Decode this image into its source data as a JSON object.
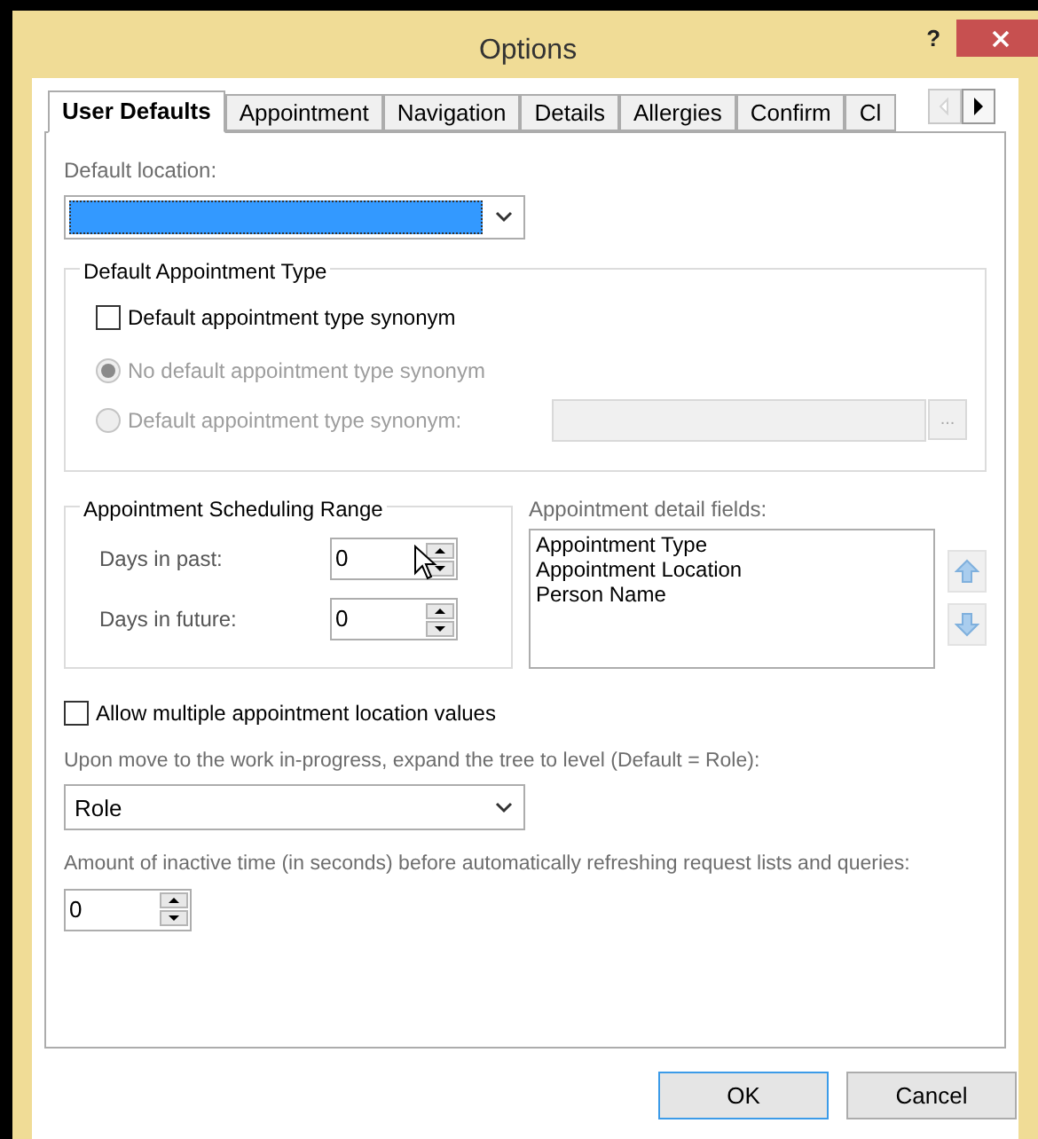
{
  "window": {
    "title": "Options",
    "help": "?"
  },
  "tabs": [
    {
      "label": "User Defaults",
      "selected": true
    },
    {
      "label": "Appointment",
      "selected": false
    },
    {
      "label": "Navigation",
      "selected": false
    },
    {
      "label": "Details",
      "selected": false
    },
    {
      "label": "Allergies",
      "selected": false
    },
    {
      "label": "Confirm",
      "selected": false
    },
    {
      "label": "Cl",
      "selected": false
    }
  ],
  "default_location": {
    "label": "Default location:",
    "highlighted": true
  },
  "appointment_type": {
    "title": "Default Appointment Type",
    "checkbox": {
      "label": "Default appointment type synonym",
      "checked": false
    },
    "radios": [
      {
        "label": "No default appointment type synonym",
        "selected": true,
        "disabled": true
      },
      {
        "label": "Default appointment type synonym:",
        "selected": false,
        "disabled": true
      }
    ],
    "browse_button": "..."
  },
  "scheduling_range": {
    "title": "Appointment Scheduling Range",
    "fields": [
      {
        "label": "Days in past:",
        "value": "0"
      },
      {
        "label": "Days in future:",
        "value": "0"
      }
    ]
  },
  "detail_fields": {
    "label": "Appointment detail fields:",
    "items": [
      "Appointment Type",
      "Appointment Location",
      "Person Name"
    ]
  },
  "allow_multiple": {
    "label": "Allow multiple appointment location values",
    "checked": false
  },
  "expand_level": {
    "label": "Upon move to the work in-progress, expand the tree to level (Default = Role):",
    "value": "Role"
  },
  "inactive_time": {
    "label": "Amount of inactive time (in seconds) before automatically refreshing request lists and queries:",
    "value": "0"
  },
  "buttons": [
    {
      "label": "OK",
      "default": true
    },
    {
      "label": "Cancel",
      "default": false
    }
  ]
}
